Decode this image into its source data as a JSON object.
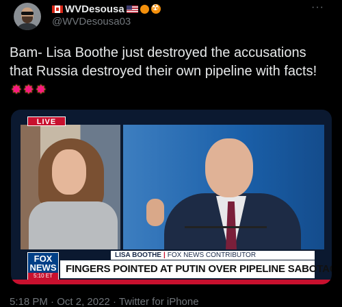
{
  "author": {
    "display_name": "WVDesousa",
    "handle": "@WVDesousa03",
    "avatar_icon": "user-avatar-icon",
    "badges": [
      "canada-flag-icon",
      "us-flag-icon",
      "orange-circle-icon",
      "radioactive-icon"
    ]
  },
  "more_icon": "···",
  "tweet": {
    "text": "Bam- Lisa Boothe just destroyed the accusations that Russia destroyed their own pipeline with facts!",
    "emojis": [
      "✸",
      "✸",
      "✸"
    ]
  },
  "media": {
    "live_label": "LIVE",
    "lower_third": {
      "name": "LISA BOOTHE",
      "separator": "|",
      "role": "FOX NEWS CONTRIBUTOR"
    },
    "logo": {
      "line1": "FOX",
      "line2": "NEWS",
      "line3": "5:10 ET"
    },
    "headline": "FINGERS POINTED AT PUTIN OVER PIPELINE SABOTAGE"
  },
  "meta": {
    "time": "5:18 PM",
    "separator1": " · ",
    "date": "Oct 2, 2022",
    "separator2": " · ",
    "source": "Twitter for iPhone"
  },
  "colors": {
    "background": "#000000",
    "text": "#e7e9ea",
    "muted": "#71767b",
    "fox_red": "#c8102e",
    "fox_blue": "#003f87"
  }
}
